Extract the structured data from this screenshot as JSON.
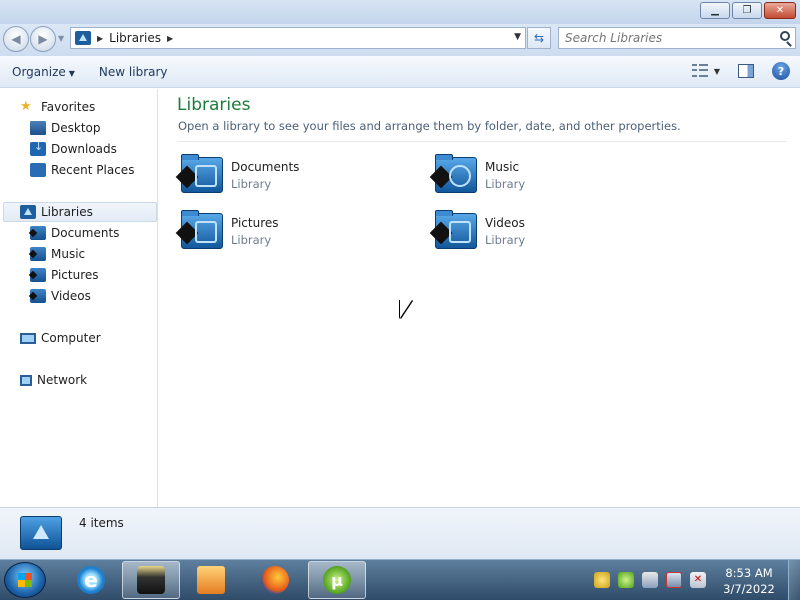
{
  "window": {
    "minimize_icon": "minimize-icon",
    "maximize_icon": "restore-icon",
    "close_icon": "close-icon"
  },
  "address": {
    "path": "Libraries",
    "search_placeholder": "Search Libraries"
  },
  "toolbar": {
    "organize": "Organize",
    "new_library": "New library"
  },
  "nav": {
    "favorites": "Favorites",
    "desktop": "Desktop",
    "downloads": "Downloads",
    "recent_places": "Recent Places",
    "libraries": "Libraries",
    "documents": "Documents",
    "music": "Music",
    "pictures": "Pictures",
    "videos": "Videos",
    "computer": "Computer",
    "network": "Network"
  },
  "content": {
    "title": "Libraries",
    "subtitle": "Open a library to see your files and arrange them by folder, date, and other properties.",
    "items": [
      {
        "name": "Documents",
        "type": "Library",
        "icon": "documents-library-icon"
      },
      {
        "name": "Music",
        "type": "Library",
        "icon": "music-library-icon"
      },
      {
        "name": "Pictures",
        "type": "Library",
        "icon": "pictures-library-icon"
      },
      {
        "name": "Videos",
        "type": "Library",
        "icon": "videos-library-icon"
      }
    ]
  },
  "details": {
    "count": "4 items"
  },
  "taskbar": {
    "time": "8:53 AM",
    "date": "3/7/2022"
  },
  "colors": {
    "title_green": "#1e7b3b",
    "link_blue": "#1e395b"
  }
}
